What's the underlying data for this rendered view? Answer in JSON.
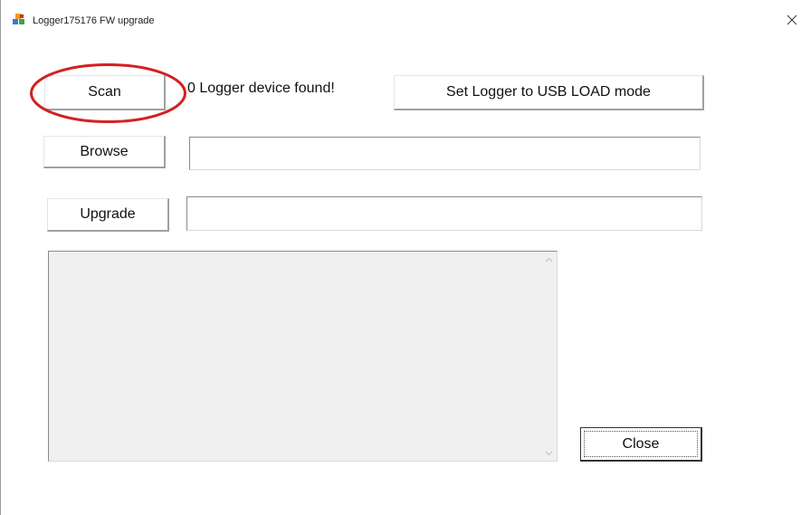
{
  "window": {
    "title": "Logger175176 FW upgrade",
    "icon": "app-logo-icon",
    "close_icon": "close-icon"
  },
  "scan": {
    "button_label": "Scan",
    "status_text": "0  Logger device found!"
  },
  "usb_load": {
    "button_label": "Set Logger to USB LOAD mode"
  },
  "browse": {
    "button_label": "Browse",
    "path_value": ""
  },
  "upgrade": {
    "button_label": "Upgrade",
    "field_value": ""
  },
  "log": {
    "text": ""
  },
  "close": {
    "button_label": "Close"
  },
  "annotation": {
    "shape": "ellipse",
    "color": "#d42020"
  }
}
